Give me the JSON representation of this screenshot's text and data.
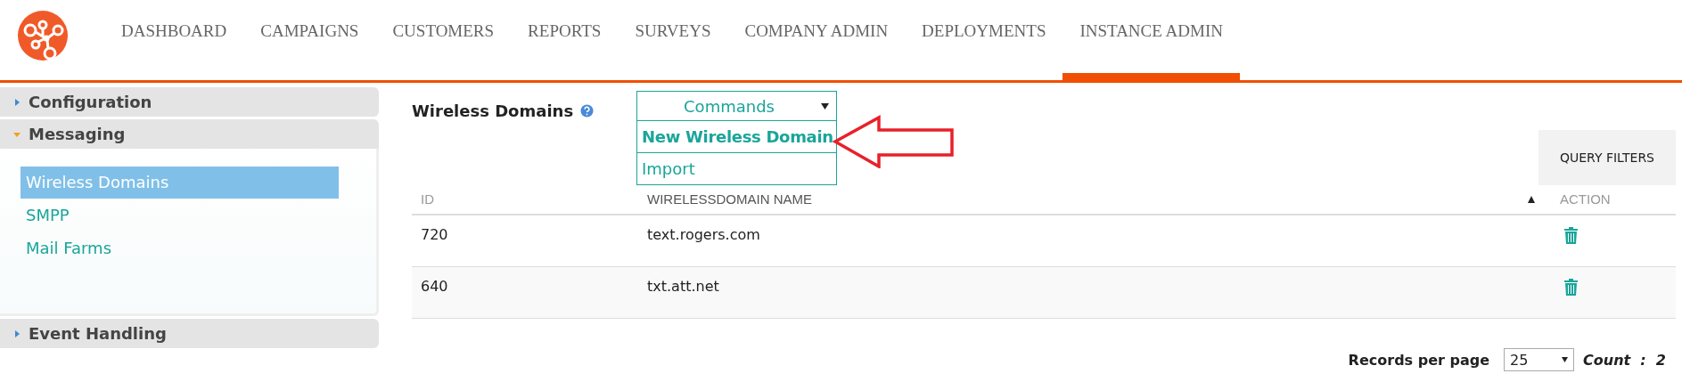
{
  "nav": [
    {
      "label": "DASHBOARD",
      "selected": false
    },
    {
      "label": "CAMPAIGNS",
      "selected": false
    },
    {
      "label": "CUSTOMERS",
      "selected": false
    },
    {
      "label": "REPORTS",
      "selected": false
    },
    {
      "label": "SURVEYS",
      "selected": false
    },
    {
      "label": "COMPANY ADMIN",
      "selected": false
    },
    {
      "label": "DEPLOYMENTS",
      "selected": false
    },
    {
      "label": "INSTANCE ADMIN",
      "selected": true
    }
  ],
  "sidebar": {
    "sections": [
      {
        "label": "Configuration",
        "expanded": false
      },
      {
        "label": "Messaging",
        "expanded": true,
        "items": [
          {
            "label": "Wireless Domains",
            "selected": true
          },
          {
            "label": "SMPP",
            "selected": false
          },
          {
            "label": "Mail Farms",
            "selected": false
          }
        ]
      },
      {
        "label": "Event Handling",
        "expanded": false
      }
    ]
  },
  "page": {
    "title": "Wireless Domains"
  },
  "commands": {
    "label": "Commands",
    "items": [
      {
        "label": "New Wireless Domain",
        "selected": true
      },
      {
        "label": "Import",
        "selected": false
      }
    ]
  },
  "query_filters": "QUERY FILTERS",
  "table": {
    "columns": [
      {
        "label": "ID",
        "sorted": false
      },
      {
        "label": "WIRELESSDOMAIN NAME",
        "sorted": true
      },
      {
        "label": "ACTION",
        "sorted": false
      }
    ],
    "rows": [
      {
        "id": "720",
        "name": "text.rogers.com"
      },
      {
        "id": "640",
        "name": "txt.att.net"
      }
    ]
  },
  "footer": {
    "records_label": "Records per page",
    "per_page": "25",
    "count": "Count  :  2"
  }
}
